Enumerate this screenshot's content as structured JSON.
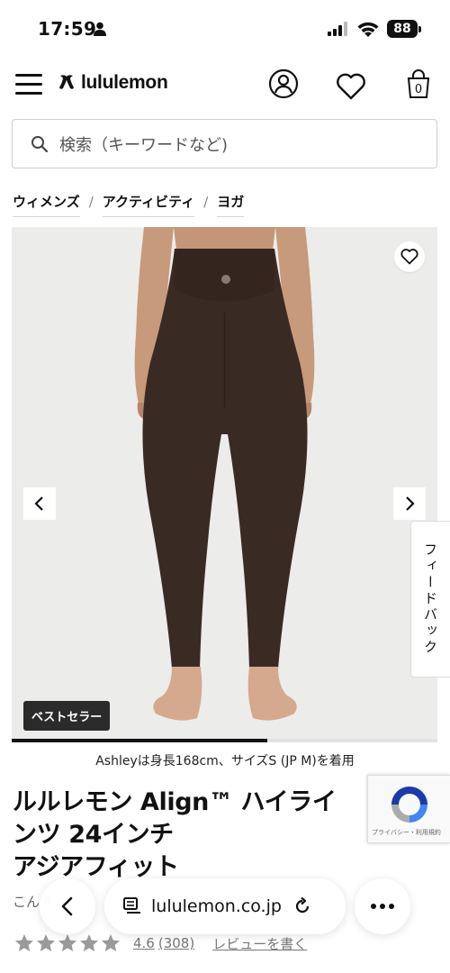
{
  "status_bar": {
    "time": "17:59",
    "battery": "88"
  },
  "header": {
    "logo_text": "lululemon",
    "bag_count": "0"
  },
  "search": {
    "placeholder": "検索（キーワードなど)"
  },
  "breadcrumb": {
    "items": [
      "ウィメンズ",
      "アクティビティ",
      "ヨガ"
    ],
    "separator": "/"
  },
  "gallery": {
    "badge": "ベストセラー",
    "progress": 0.6,
    "caption": "Ashleyは身長168cm、サイズS (JP M)を着用",
    "product_color": "#3a2a24"
  },
  "feedback_tab": "フィードバック",
  "product": {
    "title_line1": "ルルレモン Align™ ハイライ",
    "title_line2": "ンツ 24インチ",
    "title_line3": "アジアフィット",
    "subtitle_partial": "こん   il"
  },
  "recaptcha": {
    "text": "プライバシー・利用規約"
  },
  "rating": {
    "stars": 4.6,
    "score": "4.6",
    "count": "(308)",
    "review_link": "レビューを書く"
  },
  "browser": {
    "url": "lululemon.co.jp"
  }
}
